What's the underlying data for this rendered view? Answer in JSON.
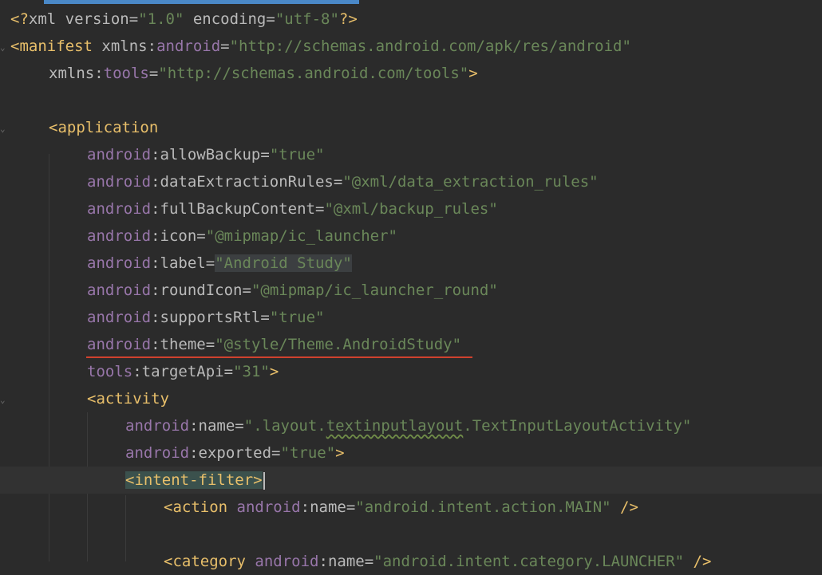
{
  "editor": {
    "lines": [
      {
        "prolog_open": "<?",
        "prolog_tag": "xml",
        "attr1": "version",
        "eq1": "=",
        "val1": "\"1.0\"",
        "attr2": "encoding",
        "eq2": "=",
        "val2": "\"utf-8\"",
        "prolog_close": "?>"
      },
      {
        "open": "<manifest",
        "ns": "xmlns",
        "colon": ":",
        "attr": "android",
        "eq": "=",
        "val": "\"http://schemas.android.com/apk/res/android\""
      },
      {
        "ns": "xmlns",
        "colon": ":",
        "attr": "tools",
        "eq": "=",
        "val": "\"http://schemas.android.com/tools\"",
        "close": ">"
      },
      {},
      {
        "open": "<application"
      },
      {
        "ns": "android",
        "colon": ":",
        "attr": "allowBackup",
        "eq": "=",
        "val": "\"true\""
      },
      {
        "ns": "android",
        "colon": ":",
        "attr": "dataExtractionRules",
        "eq": "=",
        "val": "\"@xml/data_extraction_rules\""
      },
      {
        "ns": "android",
        "colon": ":",
        "attr": "fullBackupContent",
        "eq": "=",
        "val": "\"@xml/backup_rules\""
      },
      {
        "ns": "android",
        "colon": ":",
        "attr": "icon",
        "eq": "=",
        "val": "\"@mipmap/ic_launcher\""
      },
      {
        "ns": "android",
        "colon": ":",
        "attr": "label",
        "eq": "=",
        "val": "\"Android Study\""
      },
      {
        "ns": "android",
        "colon": ":",
        "attr": "roundIcon",
        "eq": "=",
        "val": "\"@mipmap/ic_launcher_round\""
      },
      {
        "ns": "android",
        "colon": ":",
        "attr": "supportsRtl",
        "eq": "=",
        "val": "\"true\""
      },
      {
        "ns": "android",
        "colon": ":",
        "attr": "theme",
        "eq": "=",
        "val": "\"@style/Theme.AndroidStudy\""
      },
      {
        "ns": "tools",
        "colon": ":",
        "attr": "targetApi",
        "eq": "=",
        "val": "\"31\"",
        "close": ">"
      },
      {
        "open": "<activity"
      },
      {
        "ns": "android",
        "colon": ":",
        "attr": "name",
        "eq": "=",
        "val_a": "\".layout.",
        "val_b": "textinputlayout",
        "val_c": ".TextInputLayoutActivity\""
      },
      {
        "ns": "android",
        "colon": ":",
        "attr": "exported",
        "eq": "=",
        "val": "\"true\"",
        "close": ">"
      },
      {
        "open": "<intent-filter>"
      },
      {
        "open": "<action",
        "ns": "android",
        "colon": ":",
        "attr": "name",
        "eq": "=",
        "val": "\"android.intent.action.MAIN\"",
        "close": " />"
      },
      {},
      {
        "open": "<category",
        "ns": "android",
        "colon": ":",
        "attr": "name",
        "eq": "=",
        "val": "\"android.intent.category.LAUNCHER\"",
        "close": " />"
      }
    ]
  },
  "colors": {
    "background": "#2b2b2b",
    "tag": "#e8bf6a",
    "namespace": "#9876aa",
    "attribute": "#bababa",
    "string": "#6a8759",
    "error_underline": "#d0412e",
    "tab_accent": "#4a88c7"
  }
}
